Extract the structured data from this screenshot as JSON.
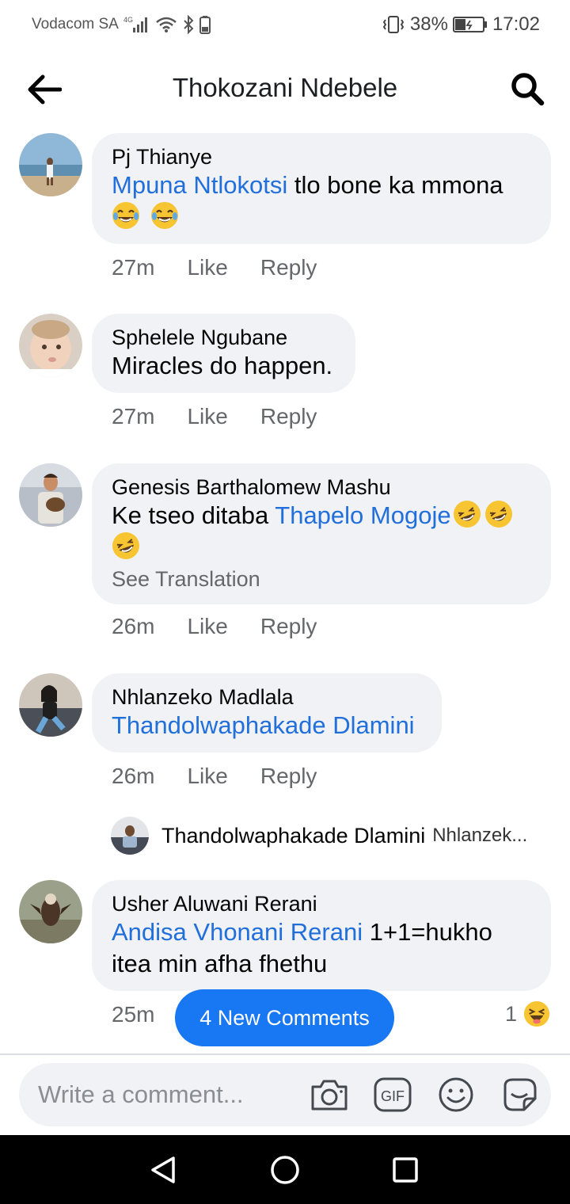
{
  "status_bar": {
    "carrier": "Vodacom SA",
    "network_badge": "4G",
    "battery_percent": "38%",
    "time": "17:02",
    "icons": [
      "signal-icon",
      "wifi-icon",
      "bluetooth-icon",
      "battery-small-icon",
      "vibrate-icon",
      "battery-charging-icon"
    ]
  },
  "header": {
    "title": "Thokozani Ndebele",
    "back_icon": "arrow-left-icon",
    "search_icon": "search-icon"
  },
  "comments": [
    {
      "author": "Pj Thianye",
      "mention": "Mpuna Ntlokotsi",
      "text": " tlo bone ka mmona",
      "emoji": [
        "joy-emoji",
        "joy-emoji"
      ],
      "time": "27m",
      "like_label": "Like",
      "reply_label": "Reply"
    },
    {
      "author": "Sphelele Ngubane",
      "text": "Miracles do happen.",
      "time": "27m",
      "like_label": "Like",
      "reply_label": "Reply"
    },
    {
      "author": "Genesis Barthalomew Mashu",
      "text_prefix": "Ke tseo ditaba ",
      "mention": "Thapelo Mogoje",
      "emoji": [
        "rofl-emoji",
        "rofl-emoji",
        "rofl-emoji"
      ],
      "see_translation": "See Translation",
      "time": "26m",
      "like_label": "Like",
      "reply_label": "Reply"
    },
    {
      "author": "Nhlanzeko Madlala",
      "mention": "Thandolwaphakade Dlamini",
      "time": "26m",
      "like_label": "Like",
      "reply_label": "Reply",
      "reply_preview": {
        "name": "Thandolwaphakade Dlamini",
        "snippet": "Nhlanzek..."
      }
    },
    {
      "author": "Usher Aluwani Rerani",
      "mention": "Andisa Vhonani Rerani",
      "text_line1": " 1+1=hukho",
      "text_line2": "itea min afha fhethu",
      "time": "25m",
      "reaction_count": "1",
      "reaction": "haha-emoji"
    }
  ],
  "new_comments_button": "4 New Comments",
  "composer": {
    "placeholder": "Write a comment...",
    "icons": [
      "camera-icon",
      "gif-icon",
      "smiley-icon",
      "sticker-icon"
    ]
  },
  "nav_bar": {
    "icons": [
      "back-triangle-icon",
      "home-circle-icon",
      "recents-square-icon"
    ]
  },
  "colors": {
    "link": "#216fdb",
    "accent": "#1877f2",
    "bubble": "#f0f2f5",
    "muted": "#65676b"
  }
}
